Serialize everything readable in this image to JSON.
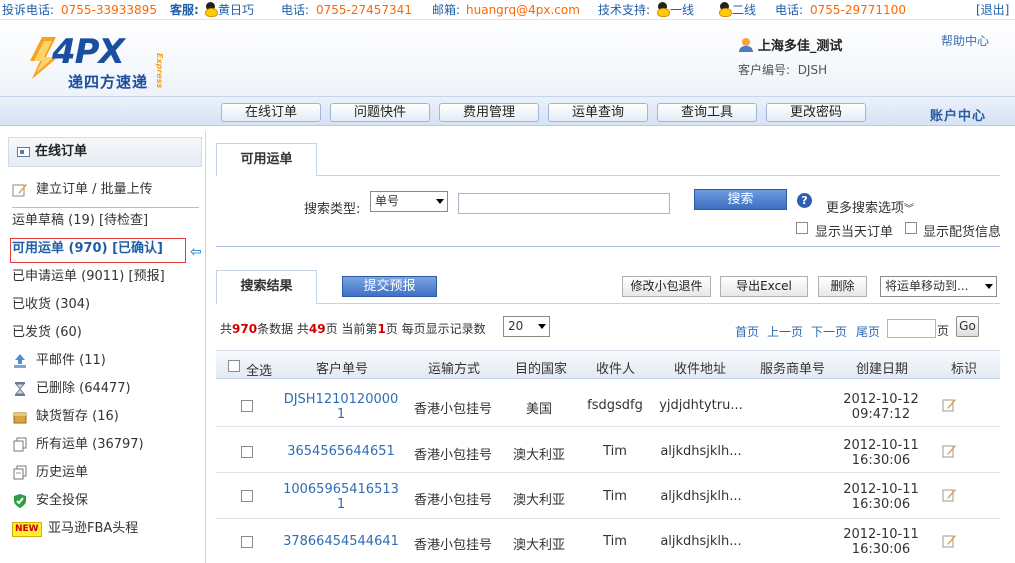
{
  "topbar": {
    "complaint_label": "投诉电话:",
    "complaint_phone": "0755-33933895",
    "service_label": "客服:",
    "service_name": "黄日巧",
    "phone_label_1": "电话:",
    "phone_1": "0755-27457341",
    "email_label": "邮箱:",
    "email": "huangrq@4px.com",
    "tech_label": "技术支持:",
    "tech_line_1": "一线",
    "tech_line_2": "二线",
    "phone_label_2": "电话:",
    "phone_2": "0755-29771100",
    "logout": "[退出]"
  },
  "header": {
    "logo_text": "4PX",
    "logo_cn": "递四方速递",
    "logo_sub": "Express",
    "user_name": "上海多佳_测试",
    "customer_code_label": "客户编号:",
    "customer_code": "DJSH",
    "help_center": "帮助中心"
  },
  "nav": {
    "items": [
      "在线订单",
      "问题快件",
      "费用管理",
      "运单查询",
      "查询工具",
      "更改密码"
    ],
    "account_center": "账户中心"
  },
  "sidebar": {
    "title": "在线订单",
    "create_order": "建立订单 / 批量上传",
    "draft": "运单草稿 (19) [待检查]",
    "available": "可用运单 (970) [已确认]",
    "applied": "已申请运单 (9011) [预报]",
    "received": "已收货 (304)",
    "shipped": "已发货 (60)",
    "flat_mail": "平邮件 (11)",
    "deleted": "已删除 (64477)",
    "out_of_stock": "缺货暂存 (16)",
    "all_orders": "所有运单 (36797)",
    "history": "历史运单",
    "insurance": "安全投保",
    "amazon_fba": "亚马逊FBA头程",
    "new_badge": "NEW"
  },
  "search": {
    "tab_label": "可用运单",
    "type_label": "搜索类型:",
    "type_value": "单号",
    "input_value": "",
    "search_button": "搜索",
    "help_symbol": "?",
    "more_options": "更多搜索选项",
    "show_today": "显示当天订单",
    "show_distribution": "显示配货信息"
  },
  "results": {
    "tab_label": "搜索结果",
    "submit_forecast": "提交预报",
    "modify_small_package": "修改小包退件",
    "export_excel": "导出Excel",
    "delete": "删除",
    "move_to": "将运单移动到...",
    "stats": {
      "prefix": "共",
      "total": "970",
      "total_suffix": "条数据 共",
      "pages": "49",
      "pages_suffix": "页 当前第",
      "current": "1",
      "current_suffix": "页 每页显示记录数"
    },
    "per_page": "20",
    "pager": {
      "first": "首页",
      "prev": "上一页",
      "next": "下一页",
      "last": "尾页",
      "page_unit": "页",
      "go": "Go"
    },
    "columns": [
      "全选",
      "客户单号",
      "运输方式",
      "目的国家",
      "收件人",
      "收件地址",
      "服务商单号",
      "创建日期",
      "标识"
    ],
    "rows": [
      {
        "order_line1": "DJSH1210120000",
        "order_line2": "1",
        "method": "香港小包挂号",
        "country": "美国",
        "recipient": "fsdgsdfg",
        "address": "yjdjdhtytru...",
        "vendor_no": "",
        "date": "2012-10-12",
        "time": "09:47:12"
      },
      {
        "order_line1": "3654565644651",
        "order_line2": "",
        "method": "香港小包挂号",
        "country": "澳大利亚",
        "recipient": "Tim",
        "address": "aljkdhsjklh...",
        "vendor_no": "",
        "date": "2012-10-11",
        "time": "16:30:06"
      },
      {
        "order_line1": "10065965416513",
        "order_line2": "1",
        "method": "香港小包挂号",
        "country": "澳大利亚",
        "recipient": "Tim",
        "address": "aljkdhsjklh...",
        "vendor_no": "",
        "date": "2012-10-11",
        "time": "16:30:06"
      },
      {
        "order_line1": "37866454544641",
        "order_line2": "",
        "method": "香港小包挂号",
        "country": "澳大利亚",
        "recipient": "Tim",
        "address": "aljkdhsjklh...",
        "vendor_no": "",
        "date": "2012-10-11",
        "time": "16:30:06"
      }
    ]
  },
  "icons": {
    "qq": "qq-penguin-icon",
    "user": "user-icon",
    "edit": "edit-note-icon",
    "back": "back-arrow-icon"
  },
  "colors": {
    "accent_blue": "#1f5fa8",
    "accent_orange": "#ff6600",
    "highlight_red": "#e63c3c"
  }
}
